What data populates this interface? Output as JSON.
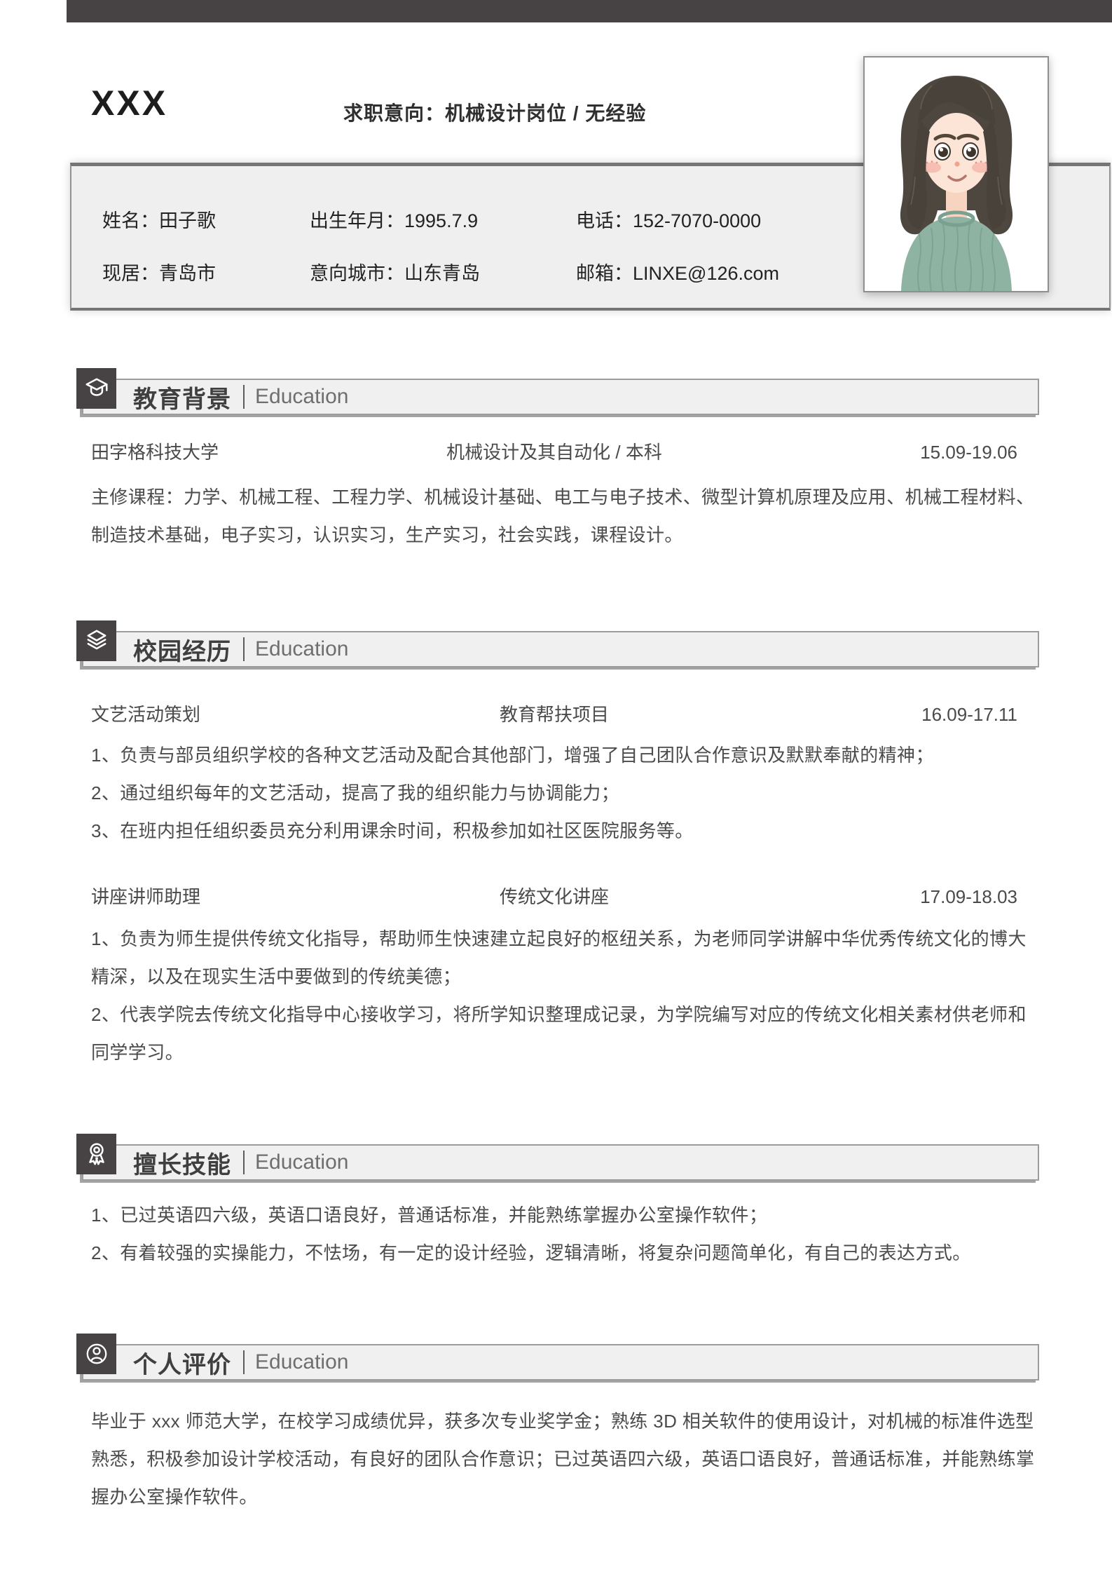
{
  "header": {
    "name": "XXX",
    "intent": "求职意向：机械设计岗位 / 无经验"
  },
  "info": {
    "fields": [
      {
        "label": "姓名：",
        "value": "田子歌"
      },
      {
        "label": "出生年月：",
        "value": "1995.7.9"
      },
      {
        "label": "电话：",
        "value": "152-7070-0000"
      },
      {
        "label": "现居：",
        "value": "青岛市"
      },
      {
        "label": "意向城市：",
        "value": "山东青岛"
      },
      {
        "label": "邮箱：",
        "value": "LINXE@126.com"
      }
    ]
  },
  "photo": {
    "description": "cartoon portrait of a girl with dark shoulder-length hair and a green sweater"
  },
  "sections": [
    {
      "title": "教育背景",
      "subtitle": "Education",
      "icon": "graduation-cap-icon"
    },
    {
      "title": "校园经历",
      "subtitle": "Education",
      "icon": "layers-icon"
    },
    {
      "title": "擅长技能",
      "subtitle": "Education",
      "icon": "medal-icon"
    },
    {
      "title": "个人评价",
      "subtitle": "Education",
      "icon": "person-icon"
    }
  ],
  "education": {
    "school": "田字格科技大学",
    "major": "机械设计及其自动化 / 本科",
    "period": "15.09-19.06",
    "courses": "主修课程：力学、机械工程、工程力学、机械设计基础、电工与电子技术、微型计算机原理及应用、机械工程材料、制造技术基础，电子实习，认识实习，生产实习，社会实践，课程设计。"
  },
  "campus": {
    "entries": [
      {
        "role": "文艺活动策划",
        "org": "教育帮扶项目",
        "period": "16.09-17.11",
        "bullets": [
          "1、负责与部员组织学校的各种文艺活动及配合其他部门，增强了自己团队合作意识及默默奉献的精神；",
          "2、通过组织每年的文艺活动，提高了我的组织能力与协调能力；",
          "3、在班内担任组织委员充分利用课余时间，积极参加如社区医院服务等。"
        ]
      },
      {
        "role": "讲座讲师助理",
        "org": "传统文化讲座",
        "period": "17.09-18.03",
        "bullets": [
          "1、负责为师生提供传统文化指导，帮助师生快速建立起良好的枢纽关系，为老师同学讲解中华优秀传统文化的博大精深，以及在现实生活中要做到的传统美德；",
          "2、代表学院去传统文化指导中心接收学习，将所学知识整理成记录，为学院编写对应的传统文化相关素材供老师和同学学习。"
        ]
      }
    ]
  },
  "skills": {
    "items": [
      "1、已过英语四六级，英语口语良好，普通话标准，并能熟练掌握办公室操作软件；",
      "2、有着较强的实操能力，不怯场，有一定的设计经验，逻辑清晰，将复杂问题简单化，有自己的表达方式。"
    ]
  },
  "evaluation": {
    "text": "毕业于 xxx 师范大学，在校学习成绩优异，获多次专业奖学金；熟练 3D 相关软件的使用设计，对机械的标准件选型熟悉，积极参加设计学校活动，有良好的团队合作意识；已过英语四六级，英语口语良好，普通话标准，并能熟练掌握办公室操作软件。"
  },
  "colors": {
    "accent_dark": "#474344",
    "section_bar_bg": "#f1f0f0",
    "section_bar_border": "#9c9c9c",
    "info_box_bg": "#f0efef",
    "body_text": "#4b4b4b",
    "sweater_green": "#8fb3a2"
  }
}
